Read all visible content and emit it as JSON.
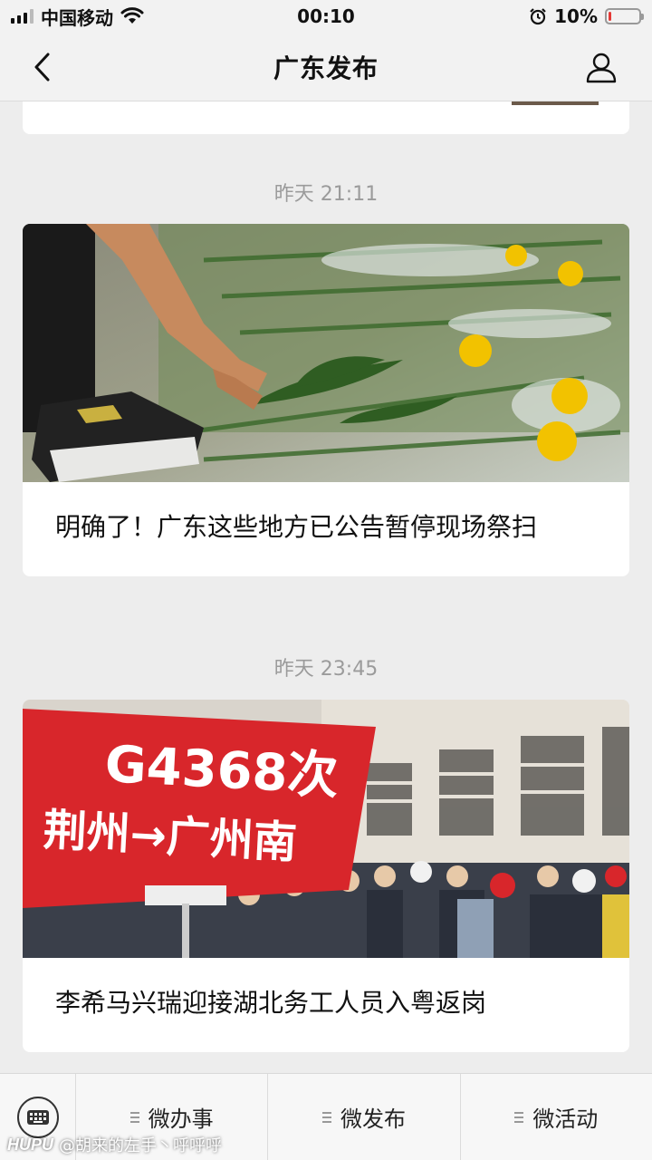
{
  "status_bar": {
    "carrier": "中国移动",
    "time": "00:10",
    "battery_percent": "10%",
    "battery_level": 0.1,
    "icons": [
      "signal-icon",
      "wifi-icon",
      "alarm-icon",
      "battery-icon"
    ]
  },
  "nav": {
    "title": "广东发布",
    "back_icon": "chevron-left-icon",
    "profile_icon": "person-icon"
  },
  "feed": {
    "items": [
      {
        "timestamp": "昨天 21:11",
        "title": "明确了！广东这些地方已公告暂停现场祭扫",
        "image": "hand-placing-chrysanthemums"
      },
      {
        "timestamp": "昨天 23:45",
        "title": "李希马兴瑞迎接湖北务工人员入粤返岗",
        "image": "train-station-crowd-sign",
        "image_sign_line1": "G4368次",
        "image_sign_line2": "荆州→广州南"
      }
    ]
  },
  "tab_bar": {
    "keyboard_icon": "keyboard-icon",
    "menus": [
      {
        "label": "微办事"
      },
      {
        "label": "微发布"
      },
      {
        "label": "微活动"
      }
    ]
  },
  "watermark": {
    "logo": "HUPU",
    "text": "@胡来的左手丶呼呼呼"
  },
  "colors": {
    "background": "#ededed",
    "card": "#ffffff",
    "timestamp": "#9b9b9b",
    "sign_red": "#d8262b"
  }
}
